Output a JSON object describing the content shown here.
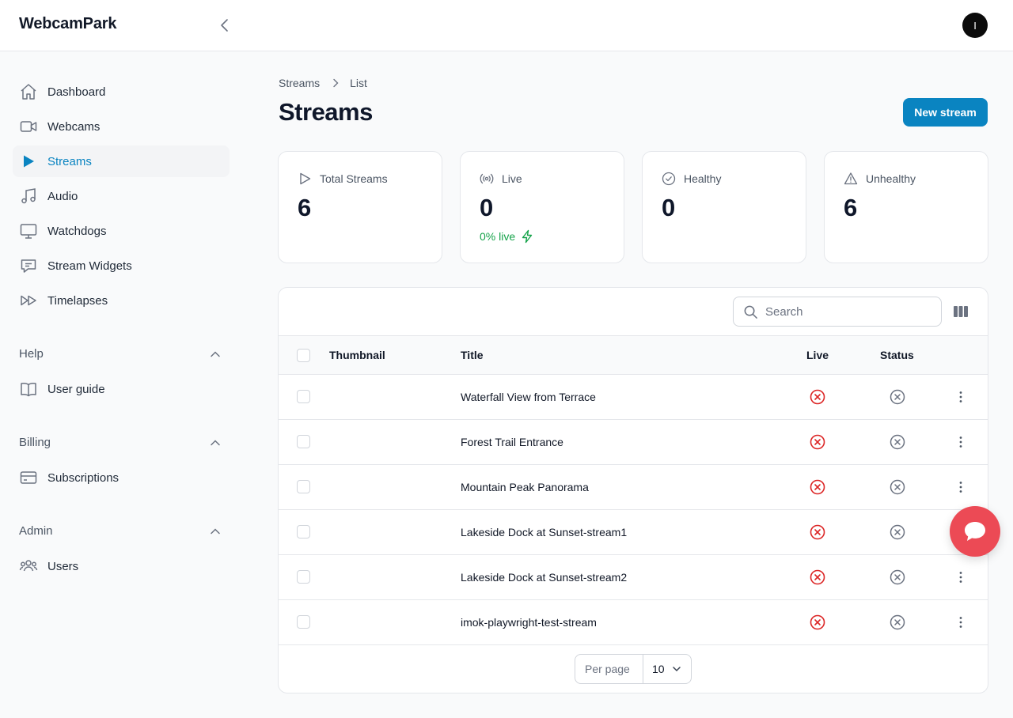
{
  "app": {
    "brand": "WebcamPark",
    "user_initial": "I"
  },
  "sidebar": {
    "items": [
      {
        "label": "Dashboard",
        "icon": "home-icon"
      },
      {
        "label": "Webcams",
        "icon": "video-camera-icon"
      },
      {
        "label": "Streams",
        "icon": "play-icon",
        "active": true
      },
      {
        "label": "Audio",
        "icon": "music-note-icon"
      },
      {
        "label": "Watchdogs",
        "icon": "monitor-icon"
      },
      {
        "label": "Stream Widgets",
        "icon": "chat-bubble-icon"
      },
      {
        "label": "Timelapses",
        "icon": "fast-forward-icon"
      }
    ],
    "groups": [
      {
        "label": "Help",
        "items": [
          {
            "label": "User guide",
            "icon": "book-icon"
          }
        ]
      },
      {
        "label": "Billing",
        "items": [
          {
            "label": "Subscriptions",
            "icon": "credit-card-icon"
          }
        ]
      },
      {
        "label": "Admin",
        "items": [
          {
            "label": "Users",
            "icon": "users-icon"
          }
        ]
      }
    ]
  },
  "breadcrumb": {
    "parent": "Streams",
    "current": "List"
  },
  "page": {
    "title": "Streams",
    "new_button": "New stream"
  },
  "stats": {
    "total": {
      "label": "Total Streams",
      "value": "6",
      "icon": "play-outline-icon"
    },
    "live": {
      "label": "Live",
      "value": "0",
      "sub": "0% live",
      "icon": "broadcast-icon"
    },
    "healthy": {
      "label": "Healthy",
      "value": "0",
      "icon": "check-circle-icon"
    },
    "unhealthy": {
      "label": "Unhealthy",
      "value": "6",
      "icon": "warning-triangle-icon"
    }
  },
  "table": {
    "search_placeholder": "Search",
    "columns": {
      "thumbnail": "Thumbnail",
      "title": "Title",
      "live": "Live",
      "status": "Status"
    },
    "rows": [
      {
        "title": "Waterfall View from Terrace",
        "live": false,
        "healthy": false
      },
      {
        "title": "Forest Trail Entrance",
        "live": false,
        "healthy": false
      },
      {
        "title": "Mountain Peak Panorama",
        "live": false,
        "healthy": false
      },
      {
        "title": "Lakeside Dock at Sunset-stream1",
        "live": false,
        "healthy": false
      },
      {
        "title": "Lakeside Dock at Sunset-stream2",
        "live": false,
        "healthy": false
      },
      {
        "title": "imok-playwright-test-stream",
        "live": false,
        "healthy": false
      }
    ],
    "pagination": {
      "per_page_label": "Per page",
      "per_page_value": "10"
    }
  },
  "colors": {
    "accent": "#0a84c1",
    "live_ok": "#16a34a",
    "error": "#dc2626",
    "chat": "#ec4a55"
  }
}
